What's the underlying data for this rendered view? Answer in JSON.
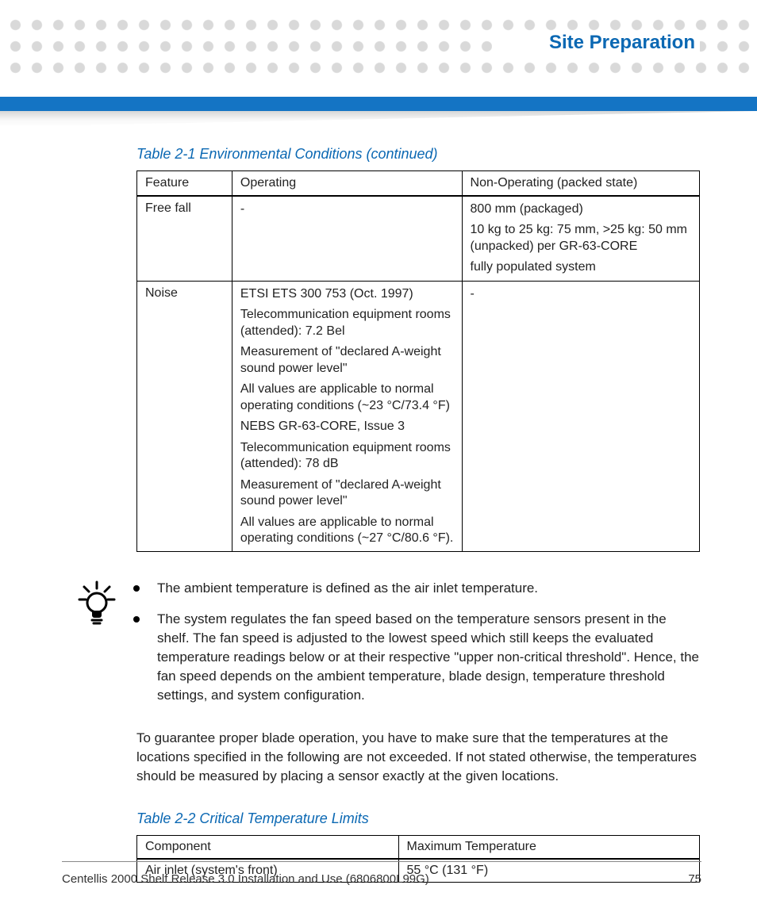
{
  "header": {
    "section_title": "Site Preparation"
  },
  "table1": {
    "caption": "Table 2-1 Environmental Conditions (continued)",
    "headers": [
      "Feature",
      "Operating",
      "Non-Operating (packed state)"
    ],
    "rows": [
      {
        "feature": "Free fall",
        "operating": [
          "-"
        ],
        "nonop": [
          "800 mm (packaged)",
          "10 kg to 25 kg: 75 mm, >25 kg: 50 mm (unpacked) per GR-63-CORE",
          "fully populated system"
        ]
      },
      {
        "feature": "Noise",
        "operating": [
          "ETSI ETS 300 753 (Oct. 1997)",
          "Telecommunication equipment rooms (attended): 7.2 Bel",
          "Measurement of \"declared A-weight sound power level\"",
          "All values are applicable to normal operating conditions (~23 °C/73.4 °F)",
          "NEBS GR-63-CORE, Issue 3",
          "Telecommunication equipment rooms (attended): 78 dB",
          "Measurement of \"declared A-weight sound power level\"",
          "All values are applicable to normal operating conditions (~27 °C/80.6 °F)."
        ],
        "nonop": [
          "-"
        ]
      }
    ]
  },
  "tip": {
    "bullets": [
      "The ambient temperature is defined as the air inlet temperature.",
      "The system regulates the fan speed based on the temperature sensors present in the shelf. The fan speed is adjusted to the lowest speed which still keeps the evaluated temperature readings below or at their respective \"upper non-critical threshold\". Hence, the fan speed depends on the ambient temperature, blade design, temperature threshold settings, and system configuration."
    ]
  },
  "para_guarantee": "To guarantee proper blade operation, you have to make sure that the temperatures at the locations specified in the following are not exceeded. If not stated otherwise, the temperatures should be measured by placing a sensor exactly at the given locations.",
  "table2": {
    "caption": "Table 2-2 Critical Temperature Limits",
    "headers": [
      "Component",
      "Maximum Temperature"
    ],
    "rows": [
      {
        "component": "Air inlet (system's front)",
        "maxtemp": "55 °C (131 °F)"
      }
    ]
  },
  "footer": {
    "doc_title": "Centellis 2000 Shelf Release 3.0 Installation and Use (6806800L99G)",
    "page_number": "75"
  }
}
